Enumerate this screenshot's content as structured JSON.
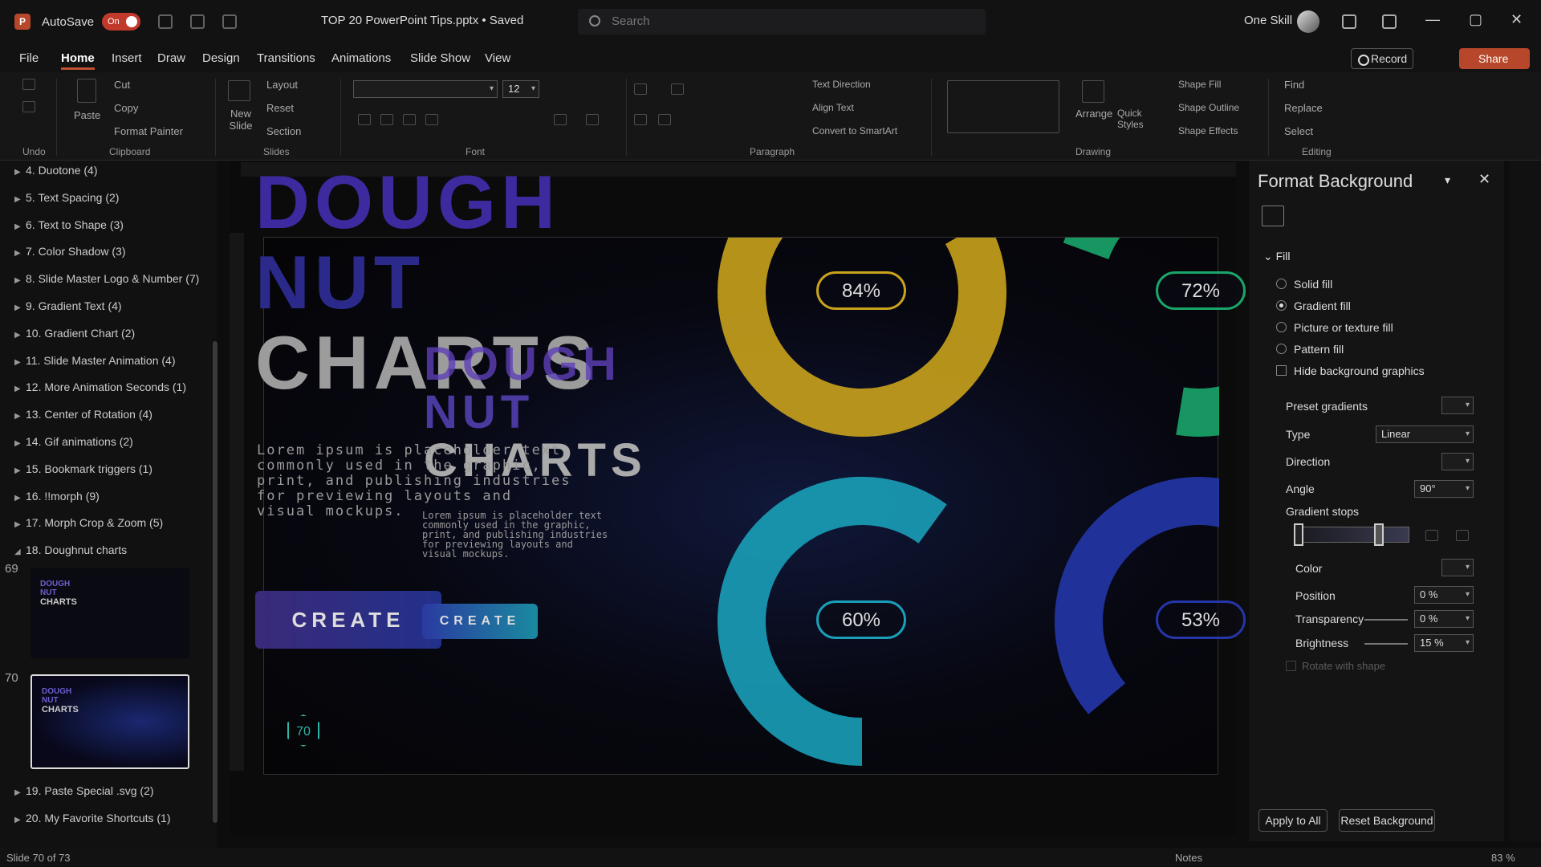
{
  "titlebar": {
    "app_logo": "P",
    "autosave_label": "AutoSave",
    "autosave_state": "On",
    "doc_title": "TOP 20 PowerPoint Tips.pptx • Saved",
    "search_placeholder": "Search",
    "user_name": "One Skill",
    "window_controls": [
      "—",
      "▢",
      "✕"
    ]
  },
  "menu": {
    "items": [
      "File",
      "Home",
      "Insert",
      "Draw",
      "Design",
      "Transitions",
      "Animations",
      "Slide Show",
      "View"
    ],
    "active": "Home",
    "record": "Record",
    "share": "Share"
  },
  "ribbon": {
    "undo_group": "Undo",
    "clipboard": {
      "group": "Clipboard",
      "paste": "Paste",
      "cut": "Cut",
      "copy": "Copy",
      "format_painter": "Format Painter"
    },
    "slides": {
      "group": "Slides",
      "new_slide": "New Slide",
      "layout": "Layout",
      "reset": "Reset",
      "section": "Section"
    },
    "font": {
      "group": "Font",
      "size": "12"
    },
    "paragraph": {
      "group": "Paragraph",
      "text_direction": "Text Direction",
      "align_text": "Align Text",
      "convert_smartart": "Convert to SmartArt"
    },
    "drawing": {
      "group": "Drawing",
      "arrange": "Arrange",
      "quick_styles": "Quick Styles",
      "shape_fill": "Shape Fill",
      "shape_outline": "Shape Outline",
      "shape_effects": "Shape Effects"
    },
    "editing": {
      "group": "Editing",
      "find": "Find",
      "replace": "Replace",
      "select": "Select"
    }
  },
  "outline": [
    {
      "label": "4. Duotone (4)"
    },
    {
      "label": "5. Text Spacing (2)"
    },
    {
      "label": "6. Text to Shape (3)"
    },
    {
      "label": "7. Color Shadow (3)"
    },
    {
      "label": "8. Slide Master Logo & Number (7)"
    },
    {
      "label": "9. Gradient Text (4)"
    },
    {
      "label": "10. Gradient Chart (2)"
    },
    {
      "label": "11. Slide Master Animation (4)"
    },
    {
      "label": "12. More Animation Seconds (1)"
    },
    {
      "label": "13. Center of Rotation (4)"
    },
    {
      "label": "14. Gif animations (2)"
    },
    {
      "label": "15. Bookmark triggers (1)"
    },
    {
      "label": "16. !!morph (9)"
    },
    {
      "label": "17. Morph Crop & Zoom (5)"
    },
    {
      "label": "18. Doughnut charts"
    }
  ],
  "outline_after": [
    {
      "label": "19. Paste Special .svg (2)"
    },
    {
      "label": "20. My Favorite Shortcuts (1)"
    }
  ],
  "thumbnails": [
    {
      "num": "69",
      "t1": "DOUGH\nNUT",
      "t2": "CHARTS"
    },
    {
      "num": "70",
      "t1": "DOUGH\nNUT",
      "t2": "CHARTS"
    }
  ],
  "slide": {
    "title_line1": "DOUGH",
    "title_line2": "NUT",
    "title_line3": "CHARTS",
    "small_title_line1": "DOUGH",
    "small_title_line2": "NUT",
    "small_title_line3": "CHARTS",
    "lorem_big": "Lorem ipsum is placeholder text\ncommonly used in the graphic,\nprint, and publishing industries\nfor previewing layouts and\nvisual mockups.",
    "lorem_small": "Lorem ipsum is placeholder text\ncommonly used in the graphic,\nprint, and publishing industries\nfor previewing layouts and\nvisual mockups.",
    "create_big": "CREATE",
    "create_small": "CREATE",
    "slide_number": "70",
    "colors": {
      "yellow": "#c9a21c",
      "green": "#1aa66a",
      "teal": "#1a9fb8",
      "blue": "#2436a8"
    }
  },
  "chart_data": [
    {
      "type": "pie",
      "label": "84%",
      "values": [
        84,
        16
      ],
      "color": "#c9a21c"
    },
    {
      "type": "pie",
      "label": "72%",
      "values": [
        72,
        28
      ],
      "color": "#1aa66a"
    },
    {
      "type": "pie",
      "label": "60%",
      "values": [
        60,
        40
      ],
      "color": "#1a9fb8"
    },
    {
      "type": "pie",
      "label": "53%",
      "values": [
        53,
        47
      ],
      "color": "#2436a8"
    }
  ],
  "pane": {
    "title": "Format Background",
    "fill_section": "Fill",
    "solid_fill": "Solid fill",
    "gradient_fill": "Gradient fill",
    "picture_fill": "Picture or texture fill",
    "pattern_fill": "Pattern fill",
    "hide_bg": "Hide background graphics",
    "preset_gradients": "Preset gradients",
    "type_label": "Type",
    "type_value": "Linear",
    "direction": "Direction",
    "angle_label": "Angle",
    "angle_value": "90°",
    "gradient_stops": "Gradient stops",
    "color": "Color",
    "position_label": "Position",
    "position_value": "0 %",
    "transparency_label": "Transparency",
    "transparency_value": "0 %",
    "brightness_label": "Brightness",
    "brightness_value": "15 %",
    "rotate_with_shape": "Rotate with shape",
    "apply_all": "Apply to All",
    "reset_bg": "Reset Background"
  },
  "statusbar": {
    "slide_info": "Slide 70 of 73",
    "notes": "Notes",
    "zoom": "83 %"
  }
}
